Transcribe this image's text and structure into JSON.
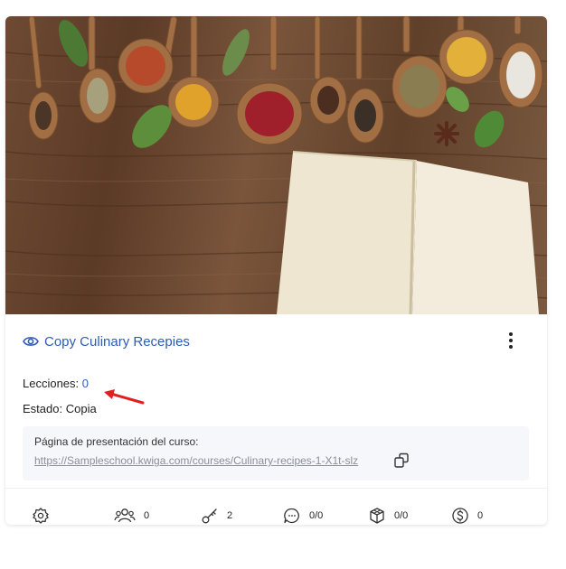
{
  "course": {
    "title": "Copy Culinary Recepies",
    "lessons_label": "Lecciones:",
    "lessons_value": "0",
    "status_label": "Estado:",
    "status_value": "Copia"
  },
  "presentation": {
    "label": "Página de presentación del curso:",
    "url": "https://Sampleschool.kwiga.com/courses/Culinary-recipes-1-X1t-slz"
  },
  "stats": {
    "settings": {
      "icon": "settings-icon"
    },
    "students": {
      "icon": "users-icon",
      "value": "0"
    },
    "keys": {
      "icon": "key-icon",
      "value": "2"
    },
    "comments": {
      "icon": "chat-icon",
      "value": "0/0"
    },
    "modules": {
      "icon": "cube-icon",
      "value": "0/0"
    },
    "payments": {
      "icon": "dollar-icon",
      "value": "0"
    }
  },
  "colors": {
    "accent": "#2f5bb7",
    "annotation_arrow": "#e02020",
    "muted": "#8a8f9a"
  }
}
